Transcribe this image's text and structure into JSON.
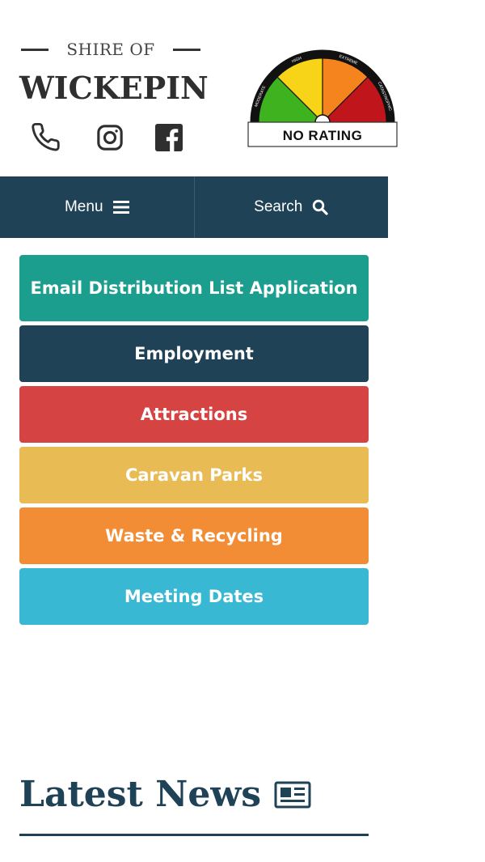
{
  "header": {
    "shire_of": "SHIRE OF",
    "brand": "WICKEPIN",
    "social": [
      {
        "name": "phone-icon"
      },
      {
        "name": "instagram-icon"
      },
      {
        "name": "facebook-icon"
      }
    ]
  },
  "fire_danger": {
    "segments": [
      "MODERATE",
      "HIGH",
      "EXTREME",
      "CATASTROPHIC"
    ],
    "colors": [
      "#3fb31f",
      "#f7d417",
      "#f5841f",
      "#c0161b"
    ],
    "status": "NO RATING"
  },
  "nav": {
    "menu_label": "Menu",
    "search_label": "Search",
    "bg_color": "#1f4256"
  },
  "quick_links": [
    {
      "label": "Email Distribution List Application",
      "color": "#1c9e8e"
    },
    {
      "label": "Employment",
      "color": "#1f4256"
    },
    {
      "label": "Attractions",
      "color": "#d64343"
    },
    {
      "label": "Caravan Parks",
      "color": "#e9bb55"
    },
    {
      "label": "Waste & Recycling",
      "color": "#f38d35"
    },
    {
      "label": "Meeting Dates",
      "color": "#38b8d2"
    }
  ],
  "news": {
    "title": "Latest News",
    "icon": "newspaper-icon"
  }
}
